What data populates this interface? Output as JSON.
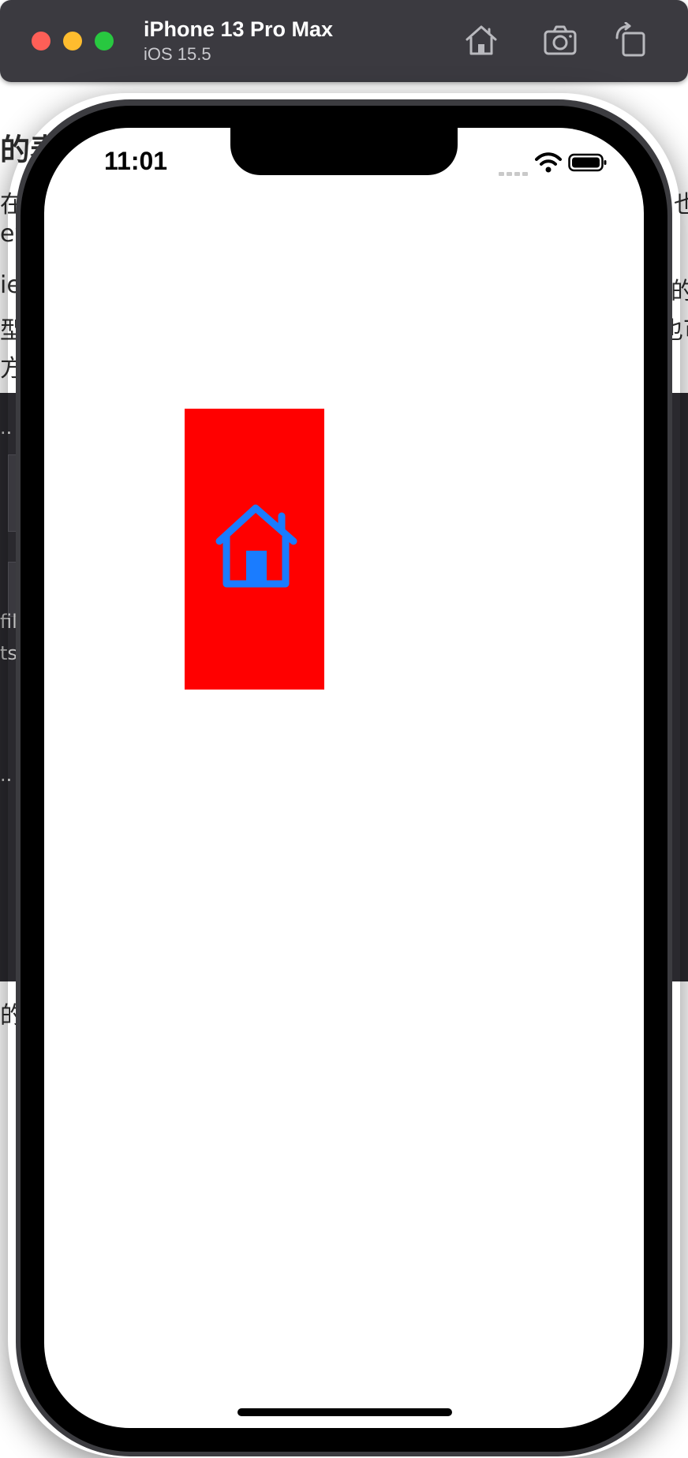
{
  "simulator": {
    "device_name": "iPhone 13 Pro Max",
    "os_version": "iOS 15.5",
    "toolbar_icons": [
      "home-icon",
      "screenshot-icon",
      "rotate-icon"
    ]
  },
  "background_page": {
    "heading_fragment": "的表",
    "line1_left": "在",
    "line1_right": "也",
    "line2_left": "ew",
    "line3_left": "ie",
    "line3_right": "的",
    "line4_left": "型",
    "line4_right": "也可",
    "line5_left": "方",
    "dark_line1": "..",
    "dark_line2": "fil",
    "dark_line3": "ts",
    "dark_line4": "..",
    "bottom_line": "的"
  },
  "status_bar": {
    "time": "11:01"
  },
  "app": {
    "icon": "house-icon",
    "colors": {
      "box": "#ff0000",
      "icon": "#1a7cff"
    }
  }
}
